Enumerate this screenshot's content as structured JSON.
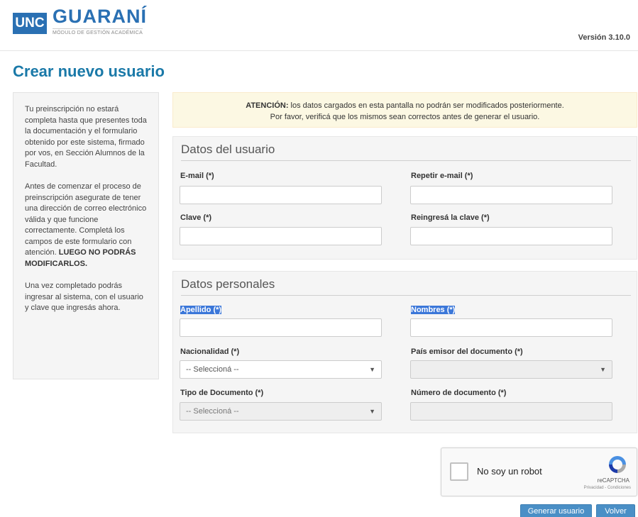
{
  "header": {
    "logo_unc": "UNC",
    "logo_guarani": "GUARANÍ",
    "logo_subtitle": "MÓDULO DE GESTIÓN ACADÉMICA",
    "version": "Versión 3.10.0"
  },
  "page": {
    "title": "Crear nuevo usuario"
  },
  "info_panel": {
    "p1": "Tu preinscripción no estará completa hasta que presentes toda la documentación y el formulario obtenido por este sistema, firmado por vos, en Sección Alumnos de la Facultad.",
    "p2_text": "Antes de comenzar el proceso de preinscripción asegurate de tener una dirección de correo electrónico válida y que funcione correctamente. Completá los campos de este formulario con atención.",
    "p2_bold": "LUEGO NO PODRÁS MODIFICARLOS.",
    "p3": "Una vez completado podrás ingresar al sistema, con el usuario y clave que ingresás ahora."
  },
  "alert": {
    "strong": "ATENCIÓN:",
    "line1": " los datos cargados en esta pantalla no podrán ser modificados posteriormente.",
    "line2": "Por favor, verificá que los mismos sean correctos antes de generar el usuario."
  },
  "datos_usuario": {
    "title": "Datos del usuario",
    "email_label": "E-mail (*)",
    "email_value": "",
    "repeat_email_label": "Repetir e-mail (*)",
    "repeat_email_value": "",
    "clave_label": "Clave (*)",
    "clave_value": "",
    "reingresa_label": "Reingresá la clave (*)",
    "reingresa_value": ""
  },
  "datos_personales": {
    "title": "Datos personales",
    "apellido_label": "Apellido (*)",
    "apellido_value": "",
    "nombres_label": "Nombres (*)",
    "nombres_value": "",
    "nacionalidad_label": "Nacionalidad (*)",
    "nacionalidad_value": "-- Seleccioná --",
    "pais_label": "País emisor del documento (*)",
    "pais_value": "",
    "tipo_doc_label": "Tipo de Documento (*)",
    "tipo_doc_value": "-- Seleccioná --",
    "numero_doc_label": "Número de documento (*)",
    "numero_doc_value": ""
  },
  "captcha": {
    "label": "No soy un robot",
    "brand": "reCAPTCHA",
    "terms": "Privacidad - Condiciones"
  },
  "buttons": {
    "generar": "Generar usuario",
    "volver": "Volver"
  },
  "colors": {
    "primary": "#2a70b3",
    "title": "#1a79a8",
    "button": "#4a8fc6",
    "alert_bg": "#fcf8e3",
    "highlight": "#3b77d9"
  }
}
